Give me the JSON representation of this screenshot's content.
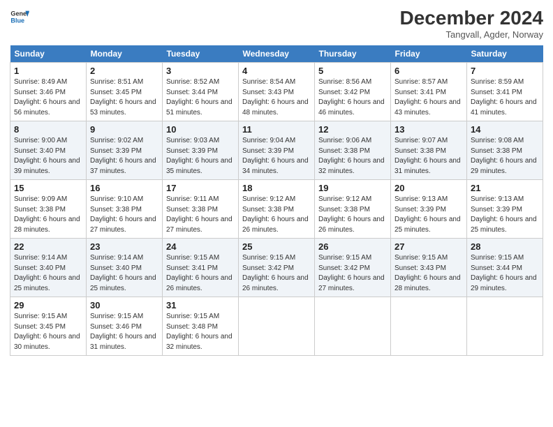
{
  "logo": {
    "line1": "General",
    "line2": "Blue"
  },
  "title": "December 2024",
  "location": "Tangvall, Agder, Norway",
  "days_of_week": [
    "Sunday",
    "Monday",
    "Tuesday",
    "Wednesday",
    "Thursday",
    "Friday",
    "Saturday"
  ],
  "weeks": [
    [
      {
        "day": "1",
        "rise": "8:49 AM",
        "set": "3:46 PM",
        "daylight": "6 hours and 56 minutes."
      },
      {
        "day": "2",
        "rise": "8:51 AM",
        "set": "3:45 PM",
        "daylight": "6 hours and 53 minutes."
      },
      {
        "day": "3",
        "rise": "8:52 AM",
        "set": "3:44 PM",
        "daylight": "6 hours and 51 minutes."
      },
      {
        "day": "4",
        "rise": "8:54 AM",
        "set": "3:43 PM",
        "daylight": "6 hours and 48 minutes."
      },
      {
        "day": "5",
        "rise": "8:56 AM",
        "set": "3:42 PM",
        "daylight": "6 hours and 46 minutes."
      },
      {
        "day": "6",
        "rise": "8:57 AM",
        "set": "3:41 PM",
        "daylight": "6 hours and 43 minutes."
      },
      {
        "day": "7",
        "rise": "8:59 AM",
        "set": "3:41 PM",
        "daylight": "6 hours and 41 minutes."
      }
    ],
    [
      {
        "day": "8",
        "rise": "9:00 AM",
        "set": "3:40 PM",
        "daylight": "6 hours and 39 minutes."
      },
      {
        "day": "9",
        "rise": "9:02 AM",
        "set": "3:39 PM",
        "daylight": "6 hours and 37 minutes."
      },
      {
        "day": "10",
        "rise": "9:03 AM",
        "set": "3:39 PM",
        "daylight": "6 hours and 35 minutes."
      },
      {
        "day": "11",
        "rise": "9:04 AM",
        "set": "3:39 PM",
        "daylight": "6 hours and 34 minutes."
      },
      {
        "day": "12",
        "rise": "9:06 AM",
        "set": "3:38 PM",
        "daylight": "6 hours and 32 minutes."
      },
      {
        "day": "13",
        "rise": "9:07 AM",
        "set": "3:38 PM",
        "daylight": "6 hours and 31 minutes."
      },
      {
        "day": "14",
        "rise": "9:08 AM",
        "set": "3:38 PM",
        "daylight": "6 hours and 29 minutes."
      }
    ],
    [
      {
        "day": "15",
        "rise": "9:09 AM",
        "set": "3:38 PM",
        "daylight": "6 hours and 28 minutes."
      },
      {
        "day": "16",
        "rise": "9:10 AM",
        "set": "3:38 PM",
        "daylight": "6 hours and 27 minutes."
      },
      {
        "day": "17",
        "rise": "9:11 AM",
        "set": "3:38 PM",
        "daylight": "6 hours and 27 minutes."
      },
      {
        "day": "18",
        "rise": "9:12 AM",
        "set": "3:38 PM",
        "daylight": "6 hours and 26 minutes."
      },
      {
        "day": "19",
        "rise": "9:12 AM",
        "set": "3:38 PM",
        "daylight": "6 hours and 26 minutes."
      },
      {
        "day": "20",
        "rise": "9:13 AM",
        "set": "3:39 PM",
        "daylight": "6 hours and 25 minutes."
      },
      {
        "day": "21",
        "rise": "9:13 AM",
        "set": "3:39 PM",
        "daylight": "6 hours and 25 minutes."
      }
    ],
    [
      {
        "day": "22",
        "rise": "9:14 AM",
        "set": "3:40 PM",
        "daylight": "6 hours and 25 minutes."
      },
      {
        "day": "23",
        "rise": "9:14 AM",
        "set": "3:40 PM",
        "daylight": "6 hours and 25 minutes."
      },
      {
        "day": "24",
        "rise": "9:15 AM",
        "set": "3:41 PM",
        "daylight": "6 hours and 26 minutes."
      },
      {
        "day": "25",
        "rise": "9:15 AM",
        "set": "3:42 PM",
        "daylight": "6 hours and 26 minutes."
      },
      {
        "day": "26",
        "rise": "9:15 AM",
        "set": "3:42 PM",
        "daylight": "6 hours and 27 minutes."
      },
      {
        "day": "27",
        "rise": "9:15 AM",
        "set": "3:43 PM",
        "daylight": "6 hours and 28 minutes."
      },
      {
        "day": "28",
        "rise": "9:15 AM",
        "set": "3:44 PM",
        "daylight": "6 hours and 29 minutes."
      }
    ],
    [
      {
        "day": "29",
        "rise": "9:15 AM",
        "set": "3:45 PM",
        "daylight": "6 hours and 30 minutes."
      },
      {
        "day": "30",
        "rise": "9:15 AM",
        "set": "3:46 PM",
        "daylight": "6 hours and 31 minutes."
      },
      {
        "day": "31",
        "rise": "9:15 AM",
        "set": "3:48 PM",
        "daylight": "6 hours and 32 minutes."
      },
      null,
      null,
      null,
      null
    ]
  ],
  "labels": {
    "sunrise": "Sunrise:",
    "sunset": "Sunset:",
    "daylight": "Daylight:"
  }
}
